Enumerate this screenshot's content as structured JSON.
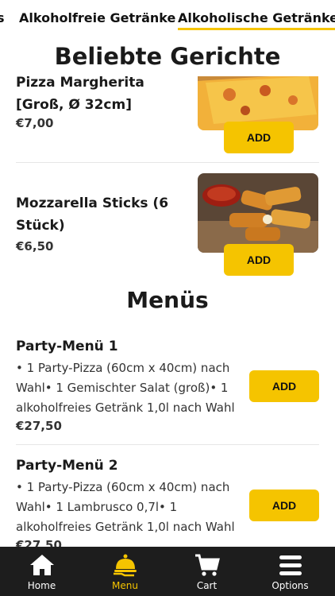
{
  "category_tabs": [
    {
      "label": "s"
    },
    {
      "label": "Alkoholfreie Getränke"
    },
    {
      "label": "Alkoholische Getränke"
    }
  ],
  "sticky_section_title": "Beliebte Gerichte",
  "popular_items": [
    {
      "name": "Pizza Margherita [Groß, Ø 32cm]",
      "price": "€7,00",
      "add_label": "ADD",
      "image": "pizza-image"
    },
    {
      "name": "Mozzarella Sticks (6 Stück)",
      "price": "€6,50",
      "add_label": "ADD",
      "image": "mozzarella-sticks-image"
    }
  ],
  "menus_section_title": "Menüs",
  "menus": [
    {
      "name": "Party-Menü 1",
      "description": "• 1 Party-Pizza (60cm x 40cm) nach Wahl• 1 Gemischter Salat (groß)• 1 alkoholfreies Getränk 1,0l nach Wahl",
      "price": "€27,50",
      "add_label": "ADD"
    },
    {
      "name": "Party-Menü 2",
      "description": "• 1 Party-Pizza (60cm x 40cm) nach Wahl• 1 Lambrusco 0,7l• 1 alkoholfreies Getränk 1,0l nach Wahl",
      "price": "€27,50",
      "add_label": "ADD"
    }
  ],
  "bottom_nav": [
    {
      "label": "Home",
      "icon": "home-icon"
    },
    {
      "label": "Menu",
      "icon": "menu-cloche-icon",
      "active": true
    },
    {
      "label": "Cart",
      "icon": "cart-icon"
    },
    {
      "label": "Options",
      "icon": "hamburger-icon"
    }
  ],
  "colors": {
    "accent": "#f5c400",
    "nav_bg": "#1d1d1d",
    "text": "#1a1a1a"
  }
}
